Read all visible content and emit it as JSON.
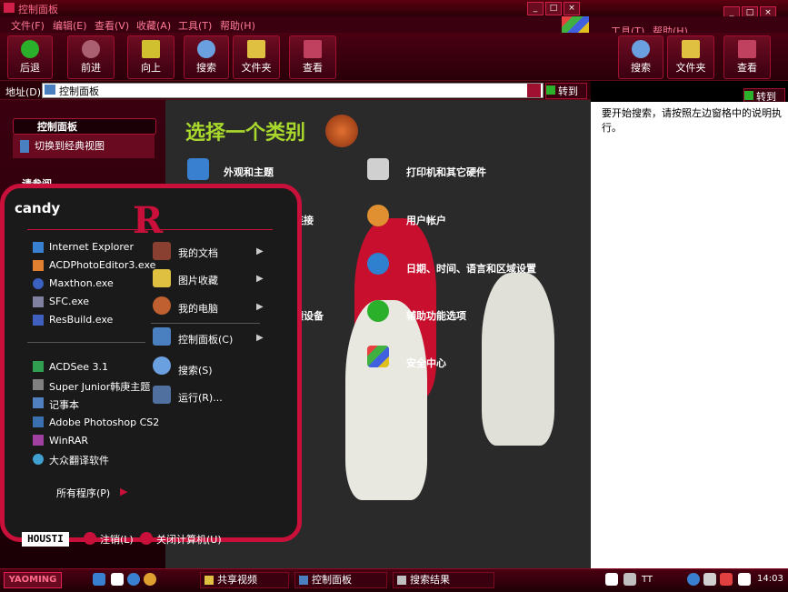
{
  "window": {
    "title": "控制面板",
    "winbtn_min": "_",
    "winbtn_max": "□",
    "winbtn_close": "×"
  },
  "menu": [
    "文件(F)",
    "编辑(E)",
    "查看(V)",
    "收藏(A)",
    "工具(T)",
    "帮助(H)"
  ],
  "right_menu": {
    "tools": "工具(T)",
    "help": "帮助(H)"
  },
  "toolbar": {
    "back": "后退",
    "forward": "前进",
    "up": "向上",
    "search": "搜索",
    "folders": "文件夹",
    "view": "查看"
  },
  "right_toolbar": {
    "search": "搜索",
    "folders": "文件夹",
    "view": "查看"
  },
  "address": {
    "label": "地址(D)",
    "value": "控制面板",
    "go": "转到"
  },
  "right_go": "转到",
  "left_panel": {
    "header": "控制面板",
    "link": "切换到经典视图",
    "section2": "请参阅"
  },
  "main": {
    "title": "选择一个类别",
    "categories": [
      "外观和主题",
      "打印机和其它硬件",
      "连接",
      "用户帐户",
      "日期、时间、语言和区域设置",
      "频设备",
      "辅助功能选项",
      "安全中心"
    ]
  },
  "right_window": {
    "text": "要开始搜索，请按照左边窗格中的说明执行。"
  },
  "start_menu": {
    "user": "candy",
    "pinned": [
      "Internet Explorer",
      "ACDPhotoEditor3.exe",
      "Maxthon.exe",
      "SFC.exe",
      "ResBuild.exe"
    ],
    "recent": [
      "ACDSee 3.1",
      "Super Junior韩庚主题",
      "记事本",
      "Adobe Photoshop CS2",
      "WinRAR",
      "大众翻译软件"
    ],
    "right_items": [
      "我的文档",
      "图片收藏",
      "我的电脑",
      "控制面板(C)",
      "搜索(S)",
      "运行(R)..."
    ],
    "all_programs": "所有程序(P)",
    "logoff": "注销(L)",
    "shutdown": "关闭计算机(U)",
    "logo": "HOUSTI"
  },
  "taskbar": {
    "start": "YAOMING",
    "tasks": [
      "共享视频",
      "控制面板",
      "搜索结果"
    ],
    "tray_text": "TT",
    "clock": "14:03"
  },
  "colors": {
    "accent": "#c8103a",
    "title_green": "#a8d82c"
  }
}
